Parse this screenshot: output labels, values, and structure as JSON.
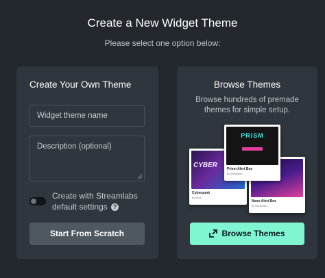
{
  "header": {
    "title": "Create a New Widget Theme",
    "subtitle": "Please select one option below:"
  },
  "own_theme": {
    "heading": "Create Your Own Theme",
    "name_placeholder": "Widget theme name",
    "description_placeholder": "Description (optional)",
    "toggle_label": "Create with Streamlabs default settings",
    "toggle_on": false,
    "help_icon": "question-circle-icon",
    "button_label": "Start From Scratch"
  },
  "browse": {
    "heading": "Browse Themes",
    "description": "Browse hundreds of premade themes for simple setup.",
    "thumbnails": [
      {
        "title": "Cyberpunk",
        "by": "By Nexa",
        "art_text": "CYBER"
      },
      {
        "title": "Prism Alert Box",
        "by": "By Streamlabs",
        "art_text": "PRISM"
      },
      {
        "title": "Neon Alert Box",
        "by": "By Streamlabs",
        "art_text": ""
      }
    ],
    "button_icon": "external-link-icon",
    "button_label": "Browse Themes"
  },
  "colors": {
    "background": "#22282d",
    "card": "#2f363d",
    "primary_button": "#80f5d2",
    "secondary_button": "#4f585f"
  }
}
